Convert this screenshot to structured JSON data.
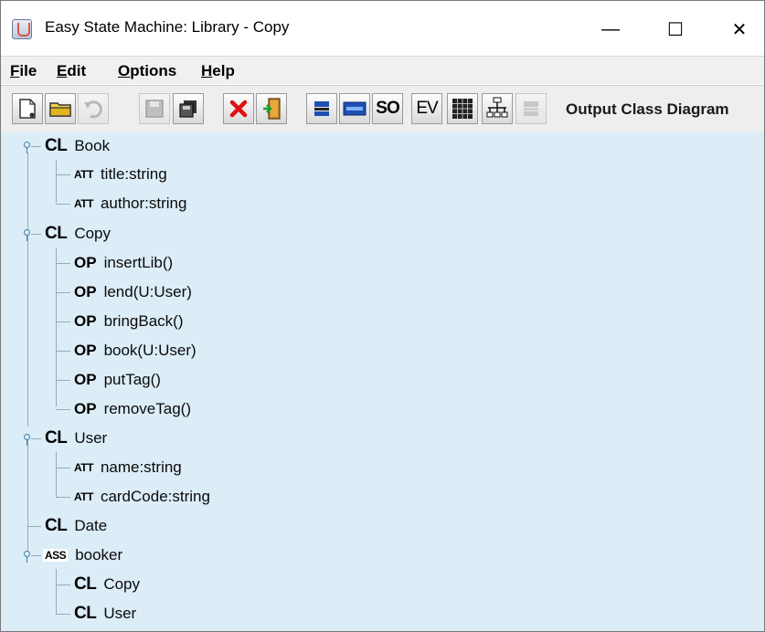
{
  "window": {
    "title": "Easy State Machine: Library - Copy",
    "minimize": "—",
    "maximize": "☐",
    "close": "✕"
  },
  "menu": {
    "file": {
      "mnemonic": "F",
      "rest": "ile"
    },
    "edit": {
      "mnemonic": "E",
      "rest": "dit"
    },
    "options": {
      "mnemonic": "O",
      "rest": "ptions"
    },
    "help": {
      "mnemonic": "H",
      "rest": "elp"
    }
  },
  "toolbar": {
    "so_label": "SO",
    "ev_label": "EV",
    "output_label": "Output Class Diagram",
    "icons": [
      "new-document-icon",
      "open-folder-icon",
      "undo-icon",
      "save-icon",
      "copy-icon",
      "delete-icon",
      "exit-icon",
      "class-icon",
      "entity-icon",
      "so-icon",
      "ev-icon",
      "table-icon",
      "tree-icon",
      "disabled-diagram-icon"
    ]
  },
  "tree": {
    "badges": {
      "class": "CL",
      "attribute": "ATT",
      "operation": "OP",
      "association": "ASS"
    },
    "book": {
      "label": "Book",
      "attrs": [
        "title:string",
        "author:string"
      ]
    },
    "copy": {
      "label": "Copy",
      "ops": [
        "insertLib()",
        "lend(U:User)",
        "bringBack()",
        "book(U:User)",
        "putTag()",
        "removeTag()"
      ]
    },
    "user": {
      "label": "User",
      "attrs": [
        "name:string",
        "cardCode:string"
      ]
    },
    "date": {
      "label": "Date"
    },
    "booker": {
      "label": "booker",
      "classes": [
        "Copy",
        "User"
      ]
    }
  },
  "colors": {
    "tree_background": "#dcedf8",
    "tree_lines": "#9aa9b5",
    "toggle_blue": "#3b7fae",
    "delete_red": "#e01010",
    "class_icon_blue": "#1f4fb5"
  }
}
